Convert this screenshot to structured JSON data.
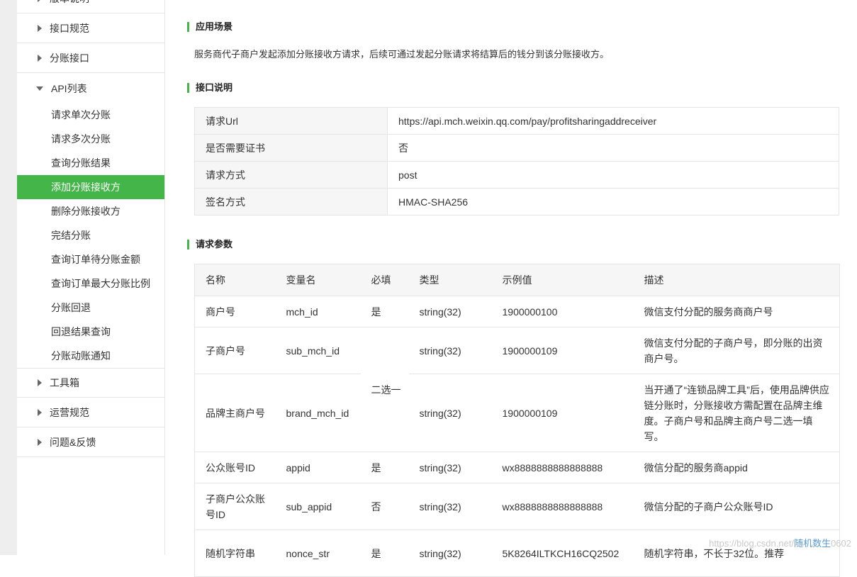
{
  "sidebar": {
    "top_partial": "版本说明",
    "items": [
      {
        "label": "接口规范"
      },
      {
        "label": "分账接口"
      },
      {
        "label": "API列表"
      }
    ],
    "sub_items": [
      {
        "label": "请求单次分账"
      },
      {
        "label": "请求多次分账"
      },
      {
        "label": "查询分账结果"
      },
      {
        "label": "添加分账接收方"
      },
      {
        "label": "删除分账接收方"
      },
      {
        "label": "完结分账"
      },
      {
        "label": "查询订单待分账金额"
      },
      {
        "label": "查询订单最大分账比例"
      },
      {
        "label": "分账回退"
      },
      {
        "label": "回退结果查询"
      },
      {
        "label": "分账动账通知"
      }
    ],
    "bottom_items": [
      {
        "label": "工具箱"
      },
      {
        "label": "运营规范"
      },
      {
        "label": "问题&反馈"
      }
    ]
  },
  "content": {
    "scene_title": "应用场景",
    "scene_desc": "服务商代子商户发起添加分账接收方请求，后续可通过发起分账请求将结算后的钱分到该分账接收方。",
    "api_title": "接口说明",
    "api_info": [
      {
        "key": "请求Url",
        "value": "https://api.mch.weixin.qq.com/pay/profitsharingaddreceiver"
      },
      {
        "key": "是否需要证书",
        "value": "否"
      },
      {
        "key": "请求方式",
        "value": "post"
      },
      {
        "key": "签名方式",
        "value": "HMAC-SHA256"
      }
    ],
    "params_title": "请求参数",
    "params_headers": [
      "名称",
      "变量名",
      "必填",
      "类型",
      "示例值",
      "描述"
    ],
    "params_rows": [
      {
        "name": "商户号",
        "var": "mch_id",
        "req": "是",
        "type": "string(32)",
        "example": "1900000100",
        "desc": "微信支付分配的服务商商户号"
      },
      {
        "name": "子商户号",
        "var": "sub_mch_id",
        "req": "二选一",
        "type": "string(32)",
        "example": "1900000109",
        "desc": "微信支付分配的子商户号，即分账的出资商户号。"
      },
      {
        "name": "品牌主商户号",
        "var": "brand_mch_id",
        "type": "string(32)",
        "example": "1900000109",
        "desc": "当开通了“连锁品牌工具”后，使用品牌供应链分账时，分账接收方需配置在品牌主维度。子商户号和品牌主商户号二选一填写。"
      },
      {
        "name": "公众账号ID",
        "var": "appid",
        "req": "是",
        "type": "string(32)",
        "example": "wx8888888888888888",
        "desc": "微信分配的服务商appid"
      },
      {
        "name": "子商户公众账号ID",
        "var": "sub_appid",
        "req": "否",
        "type": "string(32)",
        "example": "wx8888888888888888",
        "desc": "微信分配的子商户公众账号ID"
      },
      {
        "name": "随机字符串",
        "var": "nonce_str",
        "req": "是",
        "type": "string(32)",
        "example": "5K8264ILTKCH16CQ2502",
        "desc": "随机字符串，不长于32位。推荐"
      }
    ]
  },
  "watermark": {
    "text1": "https://blog.csdn.net/",
    "text2": "随机数生",
    "text3": "0602"
  }
}
